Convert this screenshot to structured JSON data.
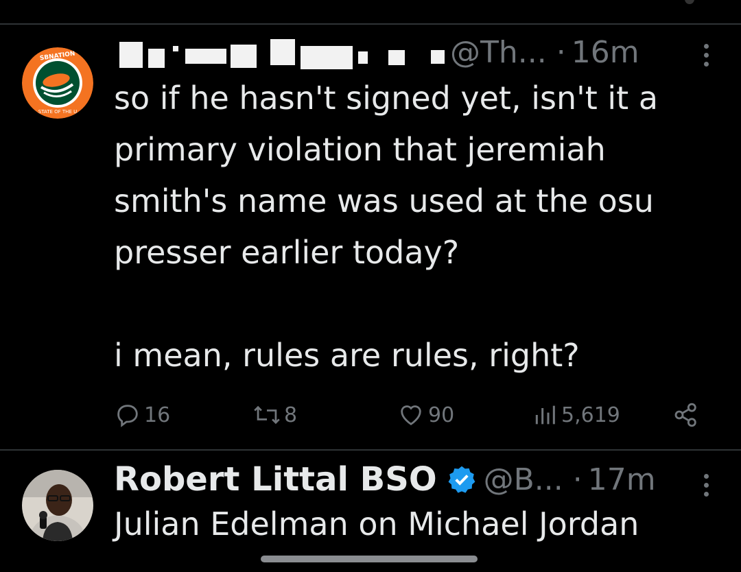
{
  "tweet1": {
    "handle": "@Th...",
    "separator": "·",
    "time": "16m",
    "text": "so if he hasn't signed yet, isn't it a\nprimary violation that jeremiah\nsmith's name was used at the osu\npresser earlier today?\n\ni mean, rules are rules, right?",
    "avatar_logo_text": "SBNATION",
    "avatar_logo_subtext": "STATE OF THE U",
    "replies": "16",
    "retweets": "8",
    "likes": "90",
    "views": "5,619"
  },
  "tweet2": {
    "name": "Robert Littal BSO",
    "handle": "@B...",
    "separator": "·",
    "time": "17m",
    "text": "Julian Edelman on Michael Jordan"
  },
  "colors": {
    "background": "#000000",
    "text": "#e7e9ea",
    "muted": "#71767b",
    "divider": "#2f3336",
    "verified": "#1d9bf0",
    "logo_orange": "#f47321",
    "logo_green": "#005030"
  },
  "icons": [
    "reply-icon",
    "retweet-icon",
    "like-icon",
    "views-icon",
    "share-icon",
    "verified-badge-icon",
    "more-icon"
  ]
}
